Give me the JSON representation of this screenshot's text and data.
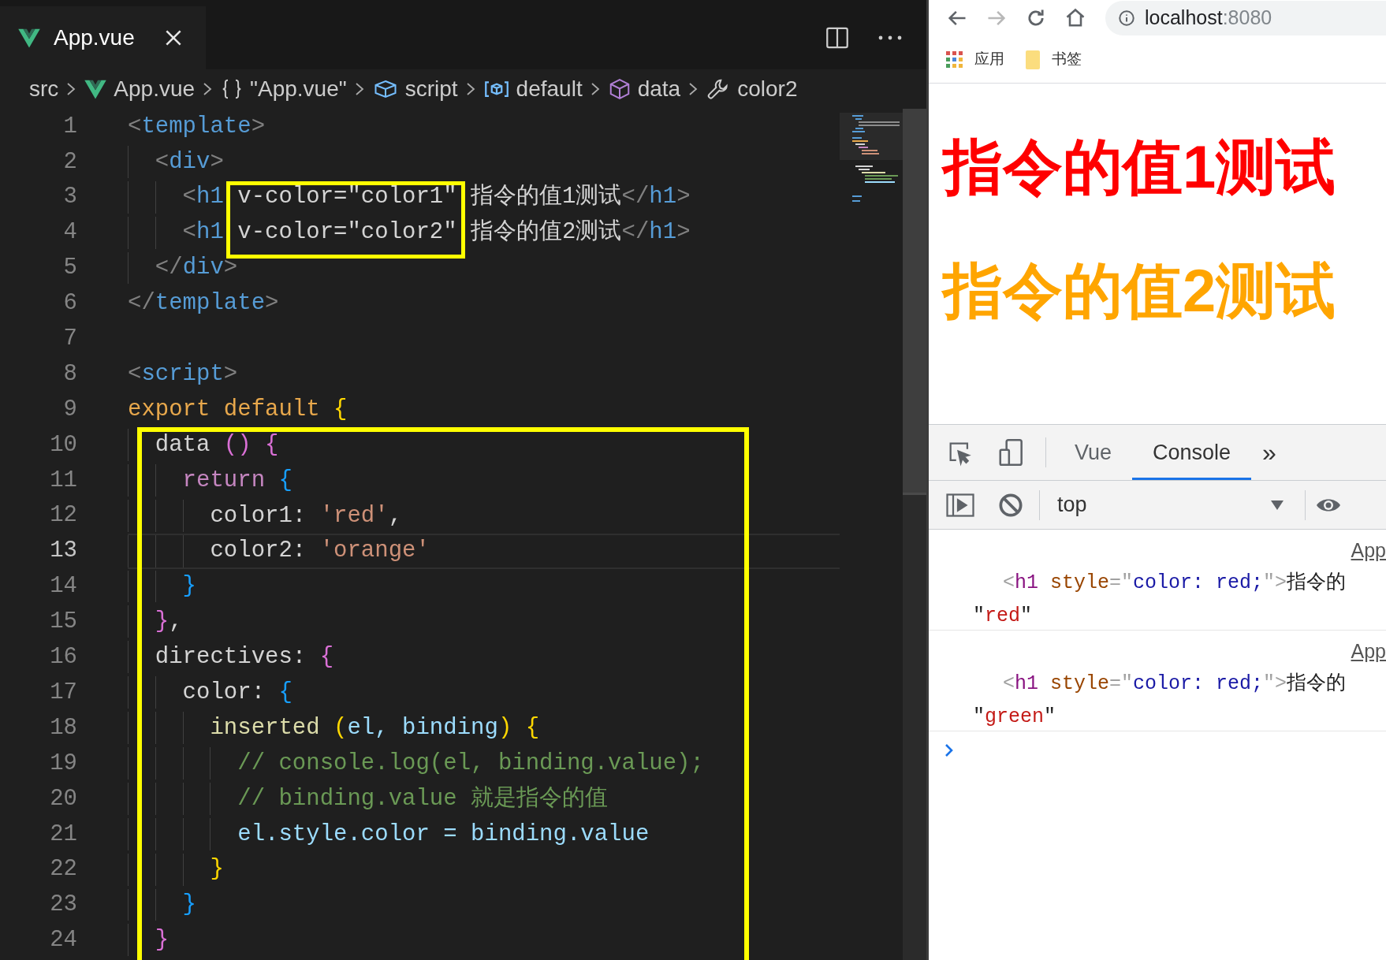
{
  "editor": {
    "tab": {
      "title": "App.vue",
      "selected": true
    },
    "breadcrumbs": [
      {
        "label": "src",
        "kind": "folder"
      },
      {
        "label": "App.vue",
        "kind": "vue"
      },
      {
        "label": "\"App.vue\"",
        "kind": "braces"
      },
      {
        "label": "script",
        "kind": "module"
      },
      {
        "label": "default",
        "kind": "field"
      },
      {
        "label": "data",
        "kind": "cube"
      },
      {
        "label": "color2",
        "kind": "wrench"
      }
    ],
    "lines": [
      {
        "number": "1",
        "current": false,
        "tokens": [
          {
            "text": "<",
            "kind": "punct"
          },
          {
            "text": "template",
            "kind": "tag"
          },
          {
            "text": ">",
            "kind": "punct"
          }
        ]
      },
      {
        "number": "2",
        "current": false,
        "tokens": [
          {
            "text": "  <",
            "kind": "punct"
          },
          {
            "text": "div",
            "kind": "tag"
          },
          {
            "text": ">",
            "kind": "punct"
          }
        ]
      },
      {
        "number": "3",
        "current": false,
        "tokens": [
          {
            "text": "    <",
            "kind": "punct"
          },
          {
            "text": "h1 ",
            "kind": "tag"
          },
          {
            "text": "v-color=\"color1\"",
            "kind": "plain",
            "framed": true
          },
          {
            "text": " 指令的值1测试",
            "kind": "plain"
          },
          {
            "text": "</",
            "kind": "punct"
          },
          {
            "text": "h1",
            "kind": "tag"
          },
          {
            "text": ">",
            "kind": "punct"
          }
        ]
      },
      {
        "number": "4",
        "current": false,
        "tokens": [
          {
            "text": "    <",
            "kind": "punct"
          },
          {
            "text": "h1 ",
            "kind": "tag"
          },
          {
            "text": "v-color=\"color2\"",
            "kind": "plain",
            "framed": true
          },
          {
            "text": " 指令的值2测试",
            "kind": "plain"
          },
          {
            "text": "</",
            "kind": "punct"
          },
          {
            "text": "h1",
            "kind": "tag"
          },
          {
            "text": ">",
            "kind": "punct"
          }
        ]
      },
      {
        "number": "5",
        "current": false,
        "tokens": [
          {
            "text": "  </",
            "kind": "punct"
          },
          {
            "text": "div",
            "kind": "tag"
          },
          {
            "text": ">",
            "kind": "punct"
          }
        ]
      },
      {
        "number": "6",
        "current": false,
        "tokens": [
          {
            "text": "</",
            "kind": "punct"
          },
          {
            "text": "template",
            "kind": "tag"
          },
          {
            "text": ">",
            "kind": "punct"
          }
        ]
      },
      {
        "number": "7",
        "current": false
      },
      {
        "number": "8",
        "current": false,
        "tokens": [
          {
            "text": "<",
            "kind": "punct"
          },
          {
            "text": "script",
            "kind": "tag"
          },
          {
            "text": ">",
            "kind": "punct"
          }
        ]
      },
      {
        "number": "9",
        "current": false,
        "tokens": [
          {
            "text": "export default ",
            "kind": "export"
          },
          {
            "text": "{",
            "kind": "bracket1"
          }
        ]
      },
      {
        "number": "10",
        "current": false,
        "framed": true,
        "tokens": [
          {
            "text": "  data ",
            "kind": "plain"
          },
          {
            "text": "() {",
            "kind": "bracket2"
          }
        ]
      },
      {
        "number": "11",
        "current": false,
        "framed": true,
        "tokens": [
          {
            "text": "    return ",
            "kind": "kw"
          },
          {
            "text": "{",
            "kind": "bracket3"
          }
        ]
      },
      {
        "number": "12",
        "current": false,
        "framed": true,
        "tokens": [
          {
            "text": "      color1: ",
            "kind": "plain"
          },
          {
            "text": "'red'",
            "kind": "str"
          },
          {
            "text": ",",
            "kind": "plain"
          }
        ]
      },
      {
        "number": "13",
        "current": true,
        "framed": true,
        "tokens": [
          {
            "text": "      color2: ",
            "kind": "plain"
          },
          {
            "text": "'orange'",
            "kind": "str"
          }
        ]
      },
      {
        "number": "14",
        "current": false,
        "framed": true,
        "tokens": [
          {
            "text": "    }",
            "kind": "bracket3"
          }
        ]
      },
      {
        "number": "15",
        "current": false,
        "framed": true,
        "tokens": [
          {
            "text": "  }",
            "kind": "bracket2"
          },
          {
            "text": ",",
            "kind": "plain"
          }
        ]
      },
      {
        "number": "16",
        "current": false,
        "framed": true,
        "tokens": [
          {
            "text": "  directives: ",
            "kind": "plain"
          },
          {
            "text": "{",
            "kind": "bracket2"
          }
        ]
      },
      {
        "number": "17",
        "current": false,
        "framed": true,
        "tokens": [
          {
            "text": "    color: ",
            "kind": "plain"
          },
          {
            "text": "{",
            "kind": "bracket3"
          }
        ]
      },
      {
        "number": "18",
        "current": false,
        "framed": true,
        "tokens": [
          {
            "text": "      inserted ",
            "kind": "func"
          },
          {
            "text": "(",
            "kind": "bracket1"
          },
          {
            "text": "el, binding",
            "kind": "var"
          },
          {
            "text": ") {",
            "kind": "bracket1"
          }
        ]
      },
      {
        "number": "19",
        "current": false,
        "framed": true,
        "tokens": [
          {
            "text": "        // console.log(el, binding.value);",
            "kind": "comment"
          }
        ]
      },
      {
        "number": "20",
        "current": false,
        "framed": true,
        "tokens": [
          {
            "text": "        // binding.value 就是指令的值",
            "kind": "comment"
          }
        ]
      },
      {
        "number": "21",
        "current": false,
        "framed": true,
        "tokens": [
          {
            "text": "        el.style.color = binding.value",
            "kind": "var"
          }
        ]
      },
      {
        "number": "22",
        "current": false,
        "framed": true,
        "tokens": [
          {
            "text": "      }",
            "kind": "bracket1"
          }
        ]
      },
      {
        "number": "23",
        "current": false,
        "framed": true,
        "tokens": [
          {
            "text": "    }",
            "kind": "bracket3"
          }
        ]
      },
      {
        "number": "24",
        "current": false,
        "framed": true,
        "tokens": [
          {
            "text": "  }",
            "kind": "bracket2"
          }
        ]
      }
    ]
  },
  "browser": {
    "nav_buttons": [
      {
        "kind": "back",
        "disabled": false
      },
      {
        "kind": "forward",
        "disabled": true
      },
      {
        "kind": "reload",
        "disabled": false
      },
      {
        "kind": "home",
        "disabled": false
      }
    ],
    "address": {
      "host": "localhost",
      "port": ":8080"
    },
    "bookmarks": [
      {
        "label": "应用",
        "kind": "apps"
      },
      {
        "label": "书签",
        "kind": "folder"
      }
    ],
    "headings": [
      {
        "text": "指令的值1测试",
        "color": "#ff0000"
      },
      {
        "text": "指令的值2测试",
        "color": "#ffa500"
      }
    ],
    "devtools": {
      "tabs": [
        {
          "label": "Vue",
          "selected": false
        },
        {
          "label": "Console",
          "selected": true
        }
      ],
      "more": "»",
      "context": "top",
      "messages": [
        {
          "source": "App",
          "tokens": [
            {
              "text": "<",
              "kind": "punct"
            },
            {
              "text": "h1",
              "kind": "tag"
            },
            {
              "text": " style",
              "kind": "attr"
            },
            {
              "text": "=\"",
              "kind": "punct"
            },
            {
              "text": "color: red;",
              "kind": "value"
            },
            {
              "text": "\">",
              "kind": "punct"
            },
            {
              "text": "指令的",
              "kind": "text"
            }
          ],
          "value_tokens": [
            {
              "text": "\"",
              "kind": "text"
            },
            {
              "text": "red",
              "kind": "string"
            },
            {
              "text": "\"",
              "kind": "text"
            }
          ]
        },
        {
          "source": "App",
          "tokens": [
            {
              "text": "<",
              "kind": "punct"
            },
            {
              "text": "h1",
              "kind": "tag"
            },
            {
              "text": " style",
              "kind": "attr"
            },
            {
              "text": "=\"",
              "kind": "punct"
            },
            {
              "text": "color: red;",
              "kind": "value"
            },
            {
              "text": "\">",
              "kind": "punct"
            },
            {
              "text": "指令的",
              "kind": "text"
            }
          ],
          "value_tokens": [
            {
              "text": "\"",
              "kind": "text"
            },
            {
              "text": "green",
              "kind": "string"
            },
            {
              "text": "\"",
              "kind": "text"
            }
          ]
        }
      ]
    }
  }
}
